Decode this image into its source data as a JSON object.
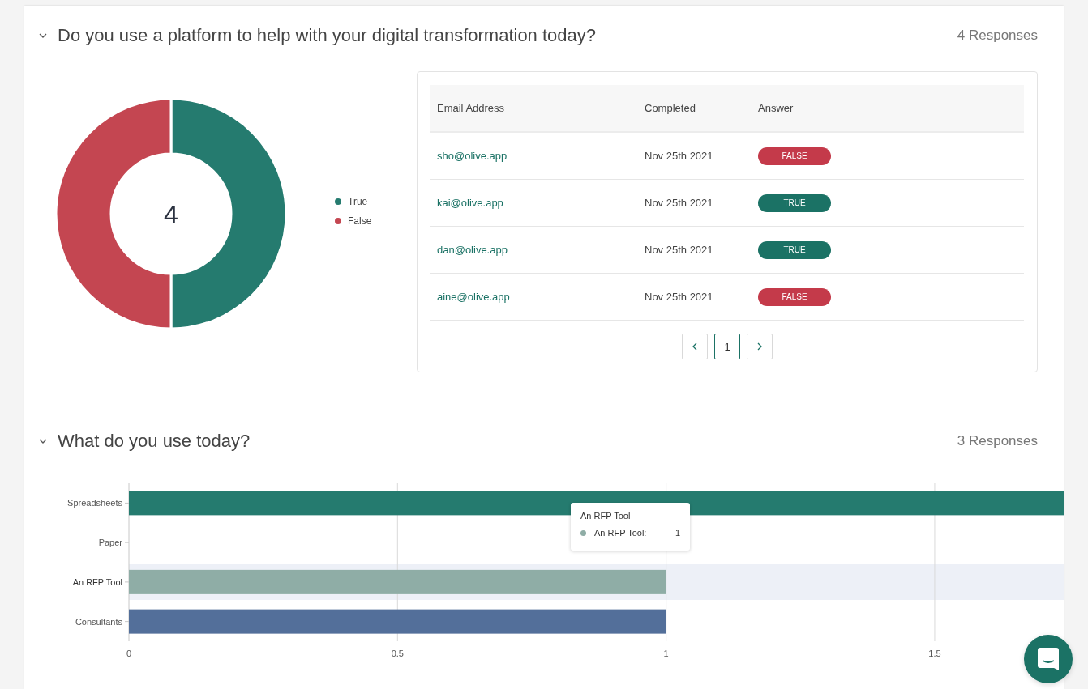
{
  "questions": [
    {
      "title": "Do you use a platform to help with your digital transformation today?",
      "responses": "4 Responses",
      "expanded": true,
      "chart_data": {
        "type": "donut",
        "categories": [
          "True",
          "False"
        ],
        "values": [
          50,
          50
        ],
        "colors": [
          "#257b6f",
          "#c44651"
        ],
        "legend": "right",
        "annotations": [
          {
            "text": "4"
          }
        ]
      },
      "table": {
        "columns": [
          "Email Address",
          "Completed",
          "Answer"
        ],
        "rows": [
          {
            "email": "sho@olive.app",
            "completed": "Nov 25th 2021",
            "answer": "FALSE",
            "value": false
          },
          {
            "email": "kai@olive.app",
            "completed": "Nov 25th 2021",
            "answer": "TRUE",
            "value": true
          },
          {
            "email": "dan@olive.app",
            "completed": "Nov 25th 2021",
            "answer": "TRUE",
            "value": true
          },
          {
            "email": "aine@olive.app",
            "completed": "Nov 25th 2021",
            "answer": "FALSE",
            "value": false
          }
        ]
      },
      "pagination": {
        "pages": [
          {
            "label": "1",
            "selected": true
          }
        ]
      }
    },
    {
      "title": "What do you use today?",
      "responses": "3 Responses",
      "expanded": true,
      "chart_data": {
        "type": "bar",
        "orientation": "horizontal",
        "categories": [
          "Spreadsheets",
          "Paper",
          "An RFP Tool",
          "Consultants"
        ],
        "series": [
          {
            "values": [
              1.74,
              0,
              1,
              1
            ]
          }
        ],
        "colors": [
          "#257b6f",
          null,
          "#8fada6",
          "#536f9a"
        ],
        "xticks": [
          0,
          0.5,
          1,
          1.5
        ],
        "xlim": [
          0,
          1.74
        ],
        "grid": true
      },
      "hovered": [
        false,
        false,
        true,
        false
      ],
      "tooltip": {
        "title": "An RFP Tool",
        "label": "An RFP Tool:",
        "value": "1",
        "color": "#8fada6"
      }
    }
  ]
}
